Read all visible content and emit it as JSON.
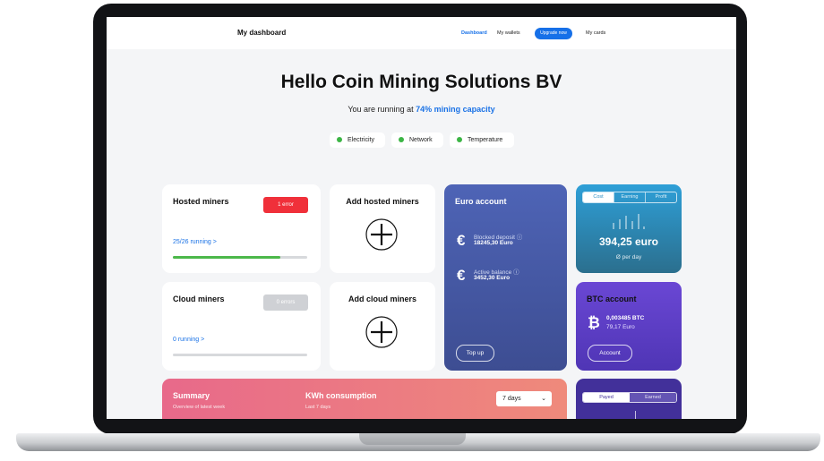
{
  "nav": {
    "brand": "My dashboard",
    "links": [
      "Dashboard",
      "My wallets",
      "Upgrade now",
      "My cards"
    ]
  },
  "header": {
    "greeting": "Hello Coin Mining Solutions BV",
    "capacity_prefix": "You are running at ",
    "capacity_value": "74% mining capacity"
  },
  "status": [
    "Electricity",
    "Network",
    "Temperature"
  ],
  "hosted": {
    "title": "Hosted miners",
    "badge": "1 error",
    "running": "25/26 running >",
    "progress": 0.8
  },
  "cloud": {
    "title": "Cloud miners",
    "badge": "0 errors",
    "running": "0 running >",
    "progress": 0
  },
  "add_hosted": {
    "title": "Add hosted miners"
  },
  "add_cloud": {
    "title": "Add cloud miners"
  },
  "euro": {
    "title": "Euro account",
    "blocked_label": "Blocked deposit ⓘ",
    "blocked_value": "18245,30 Euro",
    "active_label": "Active balance ⓘ",
    "active_value": "3452,30 Euro",
    "topup": "Top up"
  },
  "profit": {
    "tabs": [
      "Cost",
      "Earning",
      "Profit"
    ],
    "value": "394,25 euro",
    "sub": "Ø per day"
  },
  "btc": {
    "title": "BTC account",
    "btc_value": "0,003485 BTC",
    "eur_value": "79,17 Euro",
    "button": "Account"
  },
  "summary": {
    "title": "Summary",
    "subtitle": "Overview of latest week",
    "kwh_title": "KWh consumption",
    "kwh_sub": "Last 7 days",
    "range": "7 days"
  },
  "payed": {
    "tabs": [
      "Payed",
      "Earned"
    ]
  },
  "colors": {
    "accent": "#1670e8",
    "ok": "#3cb545",
    "error": "#f0303a",
    "euro_card": "#4e64b6",
    "profit_card": "#2e9fd7",
    "btc_card": "#6a47d4",
    "summary_card": "#e8698a"
  }
}
